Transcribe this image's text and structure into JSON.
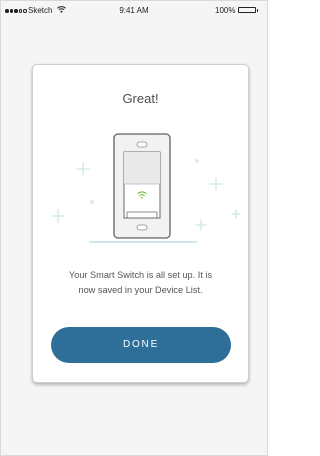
{
  "status_bar": {
    "carrier": "Sketch",
    "time": "9:41 AM",
    "battery": "100%",
    "wifi_icon": "wifi-icon",
    "battery_icon": "battery-icon"
  },
  "dialog": {
    "title": "Great!",
    "message_line_1": "Your Smart Switch is all set up. It is",
    "message_line_2": "now saved in your Device List.",
    "done_label": "DONE",
    "illustration_icon": "smart-switch-icon"
  },
  "colors": {
    "accent": "#2e6f9a",
    "led": "#7bbf3f",
    "sparkle": "#cde7e4",
    "background": "#f5f5f5"
  }
}
